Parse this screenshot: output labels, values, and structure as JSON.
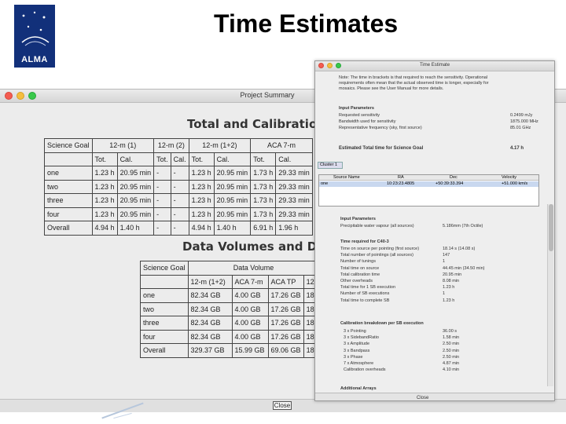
{
  "slide": {
    "title": "Time Estimates",
    "logo_text": "ALMA"
  },
  "summary_window": {
    "title": "Project Summary",
    "section1_title": "Total and Calibration Times",
    "time_table": {
      "header1": [
        "Science Goal",
        "12-m (1)",
        "12-m (2)",
        "12-m (1+2)",
        "ACA 7-m"
      ],
      "header2": [
        "",
        "Tot.",
        "Cal.",
        "Tot.",
        "Cal.",
        "Tot.",
        "Cal.",
        "Tot.",
        "Cal."
      ],
      "rows": [
        [
          "one",
          "1.23 h",
          "20.95 min",
          "-",
          "-",
          "1.23 h",
          "20.95 min",
          "1.73 h",
          "29.33 min"
        ],
        [
          "two",
          "1.23 h",
          "20.95 min",
          "-",
          "-",
          "1.23 h",
          "20.95 min",
          "1.73 h",
          "29.33 min"
        ],
        [
          "three",
          "1.23 h",
          "20.95 min",
          "-",
          "-",
          "1.23 h",
          "20.95 min",
          "1.73 h",
          "29.33 min"
        ],
        [
          "four",
          "1.23 h",
          "20.95 min",
          "-",
          "-",
          "1.23 h",
          "20.95 min",
          "1.73 h",
          "29.33 min"
        ],
        [
          "Overall",
          "4.94 h",
          "1.40 h",
          "-",
          "-",
          "4.94 h",
          "1.40 h",
          "6.91 h",
          "1.96 h"
        ]
      ]
    },
    "section2_title": "Data Volumes and Data Rates",
    "data_table": {
      "header1": [
        "Science Goal",
        "Data Volume"
      ],
      "header2": [
        "",
        "12-m (1+2)",
        "ACA 7-m",
        "ACA TP",
        "12-"
      ],
      "rows": [
        [
          "one",
          "82.34 GB",
          "4.00 GB",
          "17.26 GB",
          "18."
        ],
        [
          "two",
          "82.34 GB",
          "4.00 GB",
          "17.26 GB",
          "18."
        ],
        [
          "three",
          "82.34 GB",
          "4.00 GB",
          "17.26 GB",
          "18."
        ],
        [
          "four",
          "82.34 GB",
          "4.00 GB",
          "17.26 GB",
          "18."
        ],
        [
          "Overall",
          "329.37 GB",
          "15.99 GB",
          "69.06 GB",
          "18."
        ]
      ]
    },
    "close_label": "Close"
  },
  "estimate_window": {
    "title": "Time Estimate",
    "note": "Note: The time in brackets is that required to reach the sensitivity. Operational requirements often mean that the actual observed time is longer, especially for mosaics. Please see the User Manual for more details.",
    "input_params_heading": "Input Parameters",
    "input_params": [
      {
        "label": "Requested sensitivity",
        "value": "0.2499 mJy"
      },
      {
        "label": "Bandwidth used for sensitivity",
        "value": "1875.000 MHz"
      },
      {
        "label": "Representative frequency (sky, first source)",
        "value": "85.01 GHz"
      }
    ],
    "estimated_total_label": "Estimated Total time for Science Goal",
    "estimated_total_value": "4.17 h",
    "cluster_tab": "Cluster 1",
    "source_table": {
      "headers": [
        "Source Name",
        "RA",
        "Dec",
        "Velocity"
      ],
      "rows": [
        [
          "one",
          "10:23:23.4805",
          "+50:39:33.394",
          "+51.000 km/s"
        ]
      ]
    },
    "input_params2_heading": "Input Parameters",
    "pwv_label": "Precipitable water vapour (all sources)",
    "pwv_value": "5.186mm (7th Octile)",
    "time_required_heading": "Time required for C40-3",
    "time_required": [
      {
        "label": "Time on source per pointing (first source)",
        "value": "18.14 s (14.08 s)"
      },
      {
        "label": "Total number of pointings (all sources)",
        "value": "147"
      },
      {
        "label": "Number of tunings",
        "value": "1"
      },
      {
        "label": "Total time on source",
        "value": "44.45 min (34.50 min)"
      },
      {
        "label": "Total calibration time",
        "value": "20.95 min"
      },
      {
        "label": "Other overheads",
        "value": "8.08 min"
      },
      {
        "label": "Total time for 1 SB execution",
        "value": "1.23 h"
      },
      {
        "label": "Number of SB executions",
        "value": "1"
      },
      {
        "label": "Total time to complete SB",
        "value": "1.23 h"
      }
    ],
    "calibration_heading": "Calibration breakdown per SB execution",
    "calibration": [
      {
        "label": "3 x Pointing",
        "value": "36.00 s"
      },
      {
        "label": "3 x SidebandRatio",
        "value": "1.58 min"
      },
      {
        "label": "3 x Amplitude",
        "value": "2.50 min"
      },
      {
        "label": "3 x Bandpass",
        "value": "2.50 min"
      },
      {
        "label": "3 x Phase",
        "value": "2.50 min"
      },
      {
        "label": "7 x Atmosphere",
        "value": "4.87 min"
      },
      {
        "label": "Calibration overheads",
        "value": "4.10 min"
      }
    ],
    "additional_heading": "Additional Arrays",
    "close_label": "Close"
  }
}
